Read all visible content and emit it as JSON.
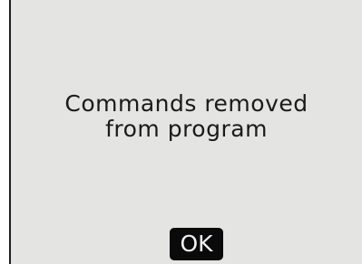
{
  "dialog": {
    "message_line1": "Commands removed",
    "message_line2": "from program",
    "ok_label": "OK"
  },
  "colors": {
    "background": "#e4e4e2",
    "text": "#1a1a1a",
    "button": "#0a0a0a",
    "button_text": "#f2f2f2"
  }
}
